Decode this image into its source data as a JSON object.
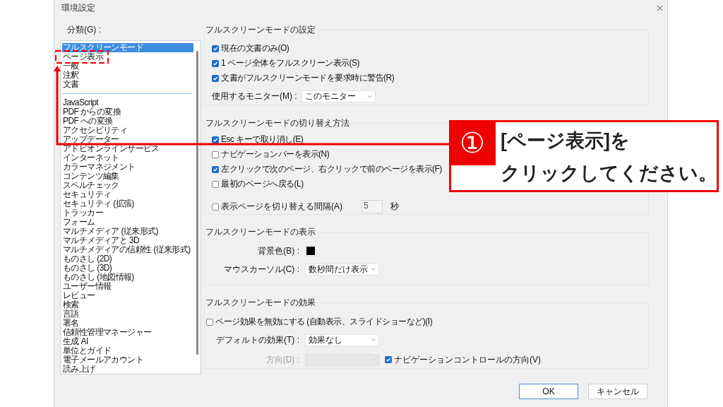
{
  "window": {
    "title": "環境設定"
  },
  "categories": {
    "label": "分類(G) :",
    "groups": [
      {
        "items": [
          {
            "label": "フルスクリーンモード",
            "selected": true
          },
          {
            "label": "ページ表示",
            "selected": false
          },
          {
            "label": "一般",
            "selected": false
          },
          {
            "label": "注釈",
            "selected": false
          },
          {
            "label": "文書",
            "selected": false
          }
        ]
      },
      {
        "items": [
          {
            "label": "JavaScript",
            "selected": false
          },
          {
            "label": "PDF からの変換",
            "selected": false
          },
          {
            "label": "PDF への変換",
            "selected": false
          },
          {
            "label": "アクセシビリティ",
            "selected": false
          },
          {
            "label": "アップデーター",
            "selected": false
          },
          {
            "label": "アドビオンラインサービス",
            "selected": false
          },
          {
            "label": "インターネット",
            "selected": false
          },
          {
            "label": "カラーマネジメント",
            "selected": false
          },
          {
            "label": "コンテンツ編集",
            "selected": false
          },
          {
            "label": "スペルチェック",
            "selected": false
          },
          {
            "label": "セキュリティ",
            "selected": false
          },
          {
            "label": "セキュリティ (拡張)",
            "selected": false
          },
          {
            "label": "トラッカー",
            "selected": false
          },
          {
            "label": "フォーム",
            "selected": false
          },
          {
            "label": "マルチメディア (従来形式)",
            "selected": false
          },
          {
            "label": "マルチメディアと 3D",
            "selected": false
          },
          {
            "label": "マルチメディアの信頼性 (従来形式)",
            "selected": false
          },
          {
            "label": "ものさし (2D)",
            "selected": false
          },
          {
            "label": "ものさし (3D)",
            "selected": false
          },
          {
            "label": "ものさし (地図情報)",
            "selected": false
          },
          {
            "label": "ユーザー情報",
            "selected": false
          },
          {
            "label": "レビュー",
            "selected": false
          },
          {
            "label": "検索",
            "selected": false
          },
          {
            "label": "言語",
            "selected": false
          },
          {
            "label": "署名",
            "selected": false
          },
          {
            "label": "信頼性管理マネージャー",
            "selected": false
          },
          {
            "label": "生成 AI",
            "selected": false
          },
          {
            "label": "単位とガイド",
            "selected": false
          },
          {
            "label": "電子メールアカウント",
            "selected": false
          },
          {
            "label": "読み上げ",
            "selected": false
          }
        ]
      }
    ]
  },
  "groups": [
    {
      "title": "フルスクリーンモードの設定",
      "rows": [
        {
          "kind": "checkbox",
          "label": "現在の文書のみ(O)",
          "checked": true
        },
        {
          "kind": "checkbox",
          "label": "1 ページ全体をフルスクリーン表示(S)",
          "checked": true
        },
        {
          "kind": "checkbox",
          "label": "文書がフルスクリーンモードを要求時に警告(R)",
          "checked": true
        },
        {
          "kind": "select",
          "label": "使用するモニター(M) :",
          "value": "このモニター"
        }
      ]
    },
    {
      "title": "フルスクリーンモードの切り替え方法",
      "rows": [
        {
          "kind": "checkbox",
          "label": "Esc キーで取り消し(E)",
          "checked": true
        },
        {
          "kind": "checkbox",
          "label": "ナビゲーションバーを表示(N)",
          "checked": false
        },
        {
          "kind": "checkbox",
          "label": "左クリックで次のページ、右クリックで前のページを表示(F)",
          "checked": true
        },
        {
          "kind": "checkbox",
          "label": "最初のページへ戻る(L)",
          "checked": false
        },
        {
          "kind": "interval",
          "label": "表示ページを切り替える間隔(A)",
          "checked": false,
          "value": "5",
          "unit": "秒",
          "disabled": true
        }
      ]
    },
    {
      "title": "フルスクリーンモードの表示",
      "rows": [
        {
          "kind": "color",
          "label": "背景色(B) :",
          "color": "#000000"
        },
        {
          "kind": "field_select",
          "label": "マウスカーソル(C) :",
          "value": "数秒間だけ表示",
          "disabled": false
        }
      ]
    },
    {
      "title": "フルスクリーンモードの効果",
      "rows": [
        {
          "kind": "checkbox",
          "label": "ページ効果を無効にする (自動表示、スライドショーなど)(I)",
          "checked": false
        },
        {
          "kind": "field_select",
          "label": "デフォルトの効果(T) :",
          "value": "効果なし",
          "disabled": false
        },
        {
          "kind": "field_select",
          "label": "方向(D) :",
          "disabled": true,
          "check": {
            "label": "ナビゲーションコントロールの方向(V)",
            "checked": true
          }
        }
      ]
    }
  ],
  "buttons": [
    {
      "label": "OK",
      "default": true
    },
    {
      "label": "キャンセル",
      "default": false
    }
  ],
  "callout": {
    "number": "①",
    "lines": [
      "[ページ表示]を",
      "クリックしてください。"
    ]
  }
}
